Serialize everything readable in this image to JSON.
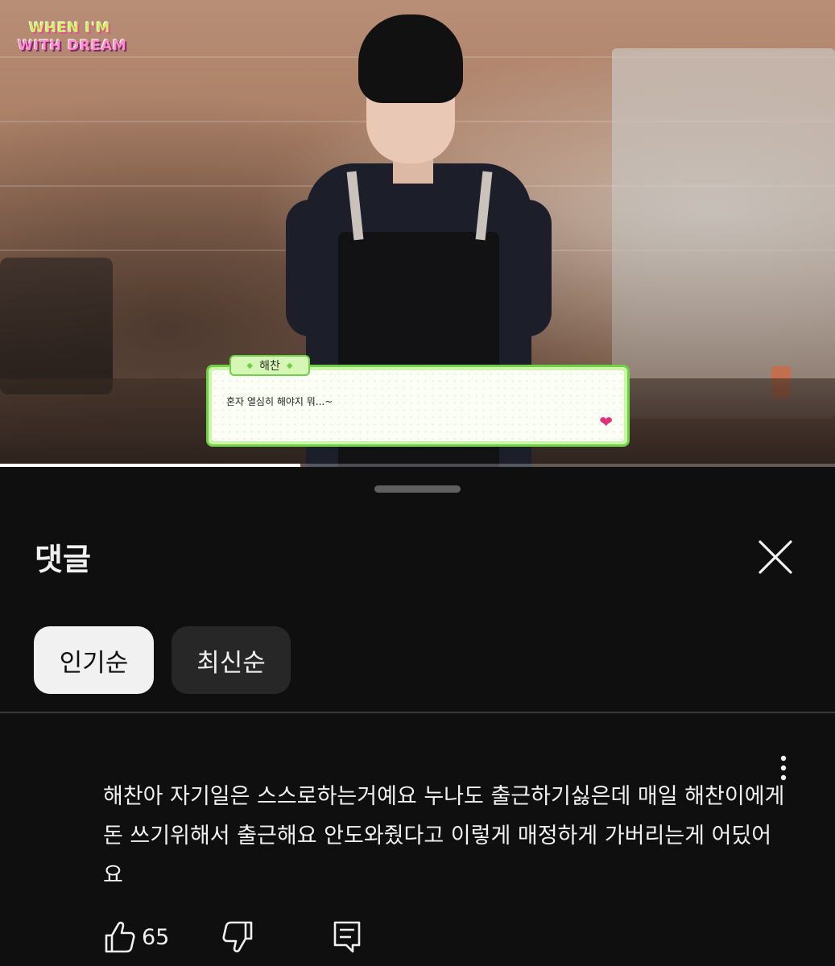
{
  "video": {
    "logo_line1": "WHEN I'M",
    "logo_line2": "WITH DREAM",
    "speaker_name": "해찬",
    "dialogue": "혼자 열심히 해야지 뭐...~",
    "progress": 0.36,
    "colors": {
      "dialog_border": "#6fcf45",
      "dialog_fill": "#cdf7a8",
      "heart": "#e0337d"
    }
  },
  "comments": {
    "title": "댓글",
    "close_icon": "close-icon",
    "sort_tabs": [
      {
        "label": "인기순",
        "selected": true
      },
      {
        "label": "최신순",
        "selected": false
      }
    ],
    "items": [
      {
        "text": "해찬아 자기일은 스스로하는거예요 누나도 출근하기싫은데 매일 해찬이에게 돈 쓰기위해서 출근해요 안도와줬다고 이렇게 매정하게 가버리는게 어딨어요",
        "likes": "65",
        "icons": [
          "thumb-up-icon",
          "thumb-down-icon",
          "reply-icon",
          "more-vert-icon"
        ]
      }
    ]
  }
}
